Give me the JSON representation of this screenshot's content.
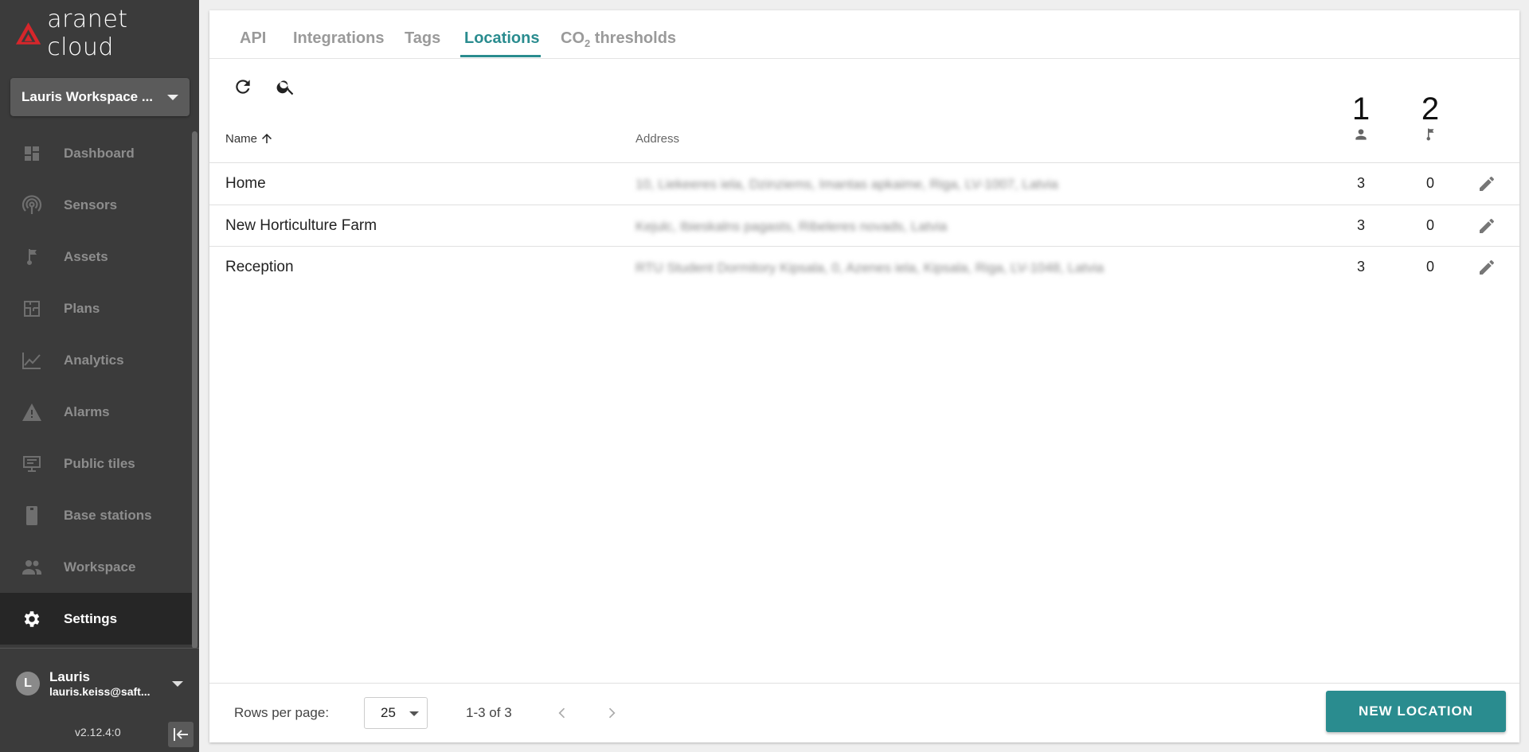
{
  "sidebar": {
    "brand": "aranet cloud",
    "workspace": "Lauris Workspace ...",
    "items": [
      {
        "label": "Dashboard",
        "icon": "dashboard-icon"
      },
      {
        "label": "Sensors",
        "icon": "sensor-icon"
      },
      {
        "label": "Assets",
        "icon": "asset-icon"
      },
      {
        "label": "Plans",
        "icon": "plan-icon"
      },
      {
        "label": "Analytics",
        "icon": "analytics-icon"
      },
      {
        "label": "Alarms",
        "icon": "alarm-icon"
      },
      {
        "label": "Public tiles",
        "icon": "public-tiles-icon"
      },
      {
        "label": "Base stations",
        "icon": "base-station-icon"
      },
      {
        "label": "Workspace",
        "icon": "workspace-icon"
      },
      {
        "label": "Settings",
        "icon": "gear-icon"
      }
    ],
    "user": {
      "initial": "L",
      "name": "Lauris",
      "email": "lauris.keiss@saft..."
    },
    "version": "v2.12.4:0"
  },
  "tabs": {
    "api": "API",
    "integrations": "Integrations",
    "tags": "Tags",
    "locations": "Locations",
    "co2_prefix": "CO",
    "co2_sub": "2",
    "co2_suffix": " thresholds"
  },
  "table": {
    "headers": {
      "name": "Name",
      "address": "Address",
      "col1_num": "1",
      "col2_num": "2"
    },
    "rows": [
      {
        "name": "Home",
        "address": "10, Liekeeres iela, Dzinziems, Imantas apkaime, Riga, LV-1007, Latvia",
        "c1": "3",
        "c2": "0"
      },
      {
        "name": "New Horticulture Farm",
        "address": "Kejulc, Ibieskalns pagasts, Ribeleres novads, Latvia",
        "c1": "3",
        "c2": "0"
      },
      {
        "name": "Reception",
        "address": "RTU Student Dormitory Kipsala, 0, Azenes iela, Kipsala, Riga, LV-1048, Latvia",
        "c1": "3",
        "c2": "0"
      }
    ]
  },
  "footer": {
    "rows_per_page_label": "Rows per page:",
    "rows_per_page_value": "25",
    "range": "1-3 of 3",
    "new_button": "NEW LOCATION"
  },
  "colors": {
    "accent": "#2a8c8f",
    "sidebar": "#3b3b3b",
    "logo_red": "#d7262b"
  }
}
